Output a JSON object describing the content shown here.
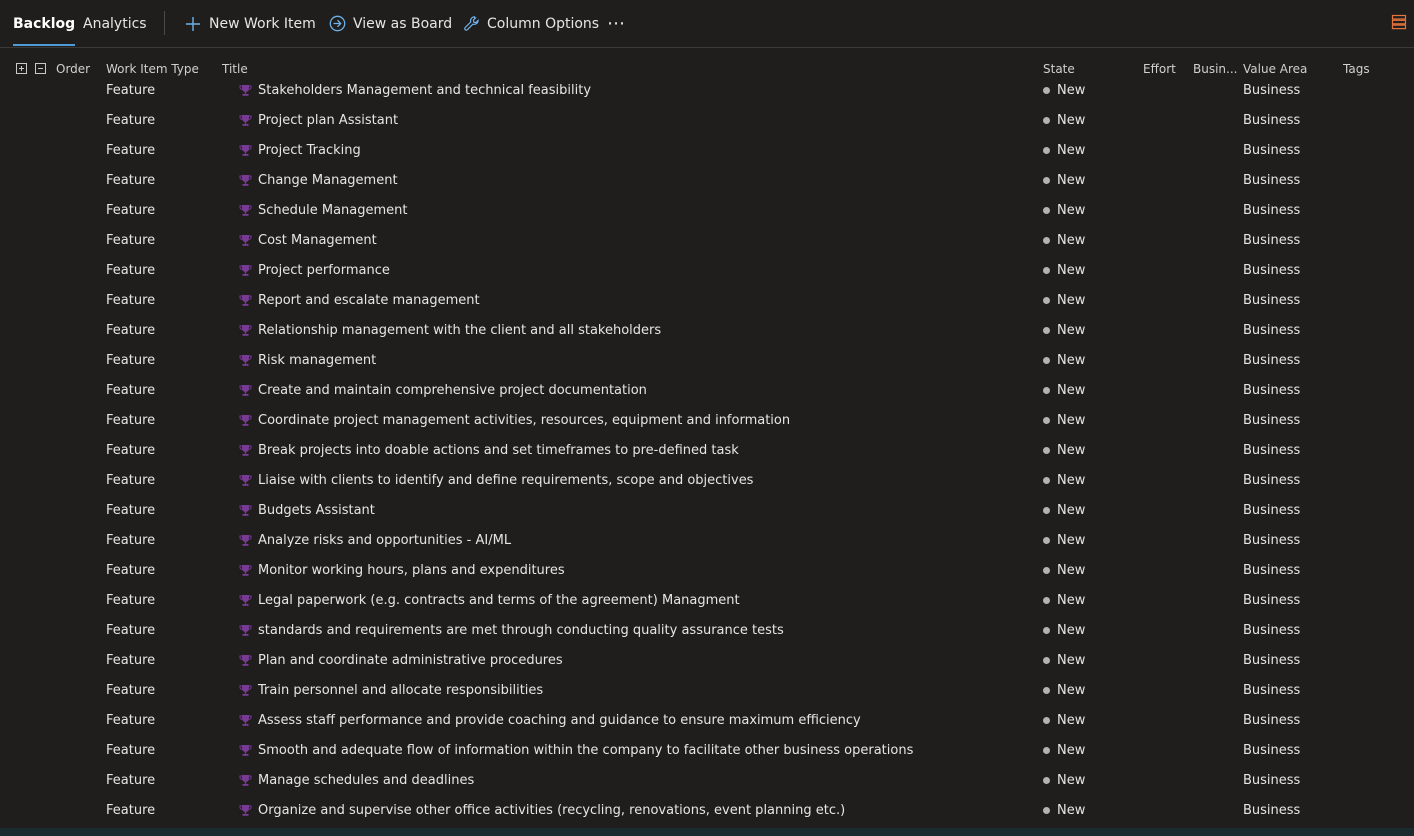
{
  "toolbar": {
    "tabs": [
      {
        "label": "Backlog",
        "active": true
      },
      {
        "label": "Analytics",
        "active": false
      }
    ],
    "new_work_item_label": "New Work Item",
    "view_as_board_label": "View as Board",
    "column_options_label": "Column Options",
    "more_label": "⋯",
    "icons": {
      "new": "plus-icon",
      "board": "arrow-circle-right-icon",
      "columns": "wrench-icon",
      "side_panel": "side-panel-icon"
    },
    "accent_color": "#e8743b"
  },
  "grid": {
    "columns": {
      "order": "Order",
      "type": "Work Item Type",
      "title": "Title",
      "state": "State",
      "effort": "Effort",
      "business": "Busin...",
      "value_area": "Value Area",
      "tags": "Tags"
    },
    "trophy_color": "#773b93",
    "rows": [
      {
        "type": "Feature",
        "title": "Stakeholders Management and technical feasibility",
        "state": "New",
        "value_area": "Business"
      },
      {
        "type": "Feature",
        "title": "Project plan Assistant",
        "state": "New",
        "value_area": "Business"
      },
      {
        "type": "Feature",
        "title": "Project Tracking",
        "state": "New",
        "value_area": "Business"
      },
      {
        "type": "Feature",
        "title": "Change Management",
        "state": "New",
        "value_area": "Business"
      },
      {
        "type": "Feature",
        "title": "Schedule Management",
        "state": "New",
        "value_area": "Business"
      },
      {
        "type": "Feature",
        "title": "Cost Management",
        "state": "New",
        "value_area": "Business"
      },
      {
        "type": "Feature",
        "title": "Project performance",
        "state": "New",
        "value_area": "Business"
      },
      {
        "type": "Feature",
        "title": "Report and escalate management",
        "state": "New",
        "value_area": "Business"
      },
      {
        "type": "Feature",
        "title": "Relationship management with the client and all stakeholders",
        "state": "New",
        "value_area": "Business"
      },
      {
        "type": "Feature",
        "title": "Risk management",
        "state": "New",
        "value_area": "Business"
      },
      {
        "type": "Feature",
        "title": "Create and maintain comprehensive project documentation",
        "state": "New",
        "value_area": "Business"
      },
      {
        "type": "Feature",
        "title": "Coordinate project management activities, resources, equipment and information",
        "state": "New",
        "value_area": "Business"
      },
      {
        "type": "Feature",
        "title": "Break projects into doable actions and set timeframes to pre-defined task",
        "state": "New",
        "value_area": "Business"
      },
      {
        "type": "Feature",
        "title": "Liaise with clients to identify and define requirements, scope and objectives",
        "state": "New",
        "value_area": "Business"
      },
      {
        "type": "Feature",
        "title": "Budgets Assistant",
        "state": "New",
        "value_area": "Business"
      },
      {
        "type": "Feature",
        "title": "Analyze risks and opportunities - AI/ML",
        "state": "New",
        "value_area": "Business"
      },
      {
        "type": "Feature",
        "title": "Monitor working hours, plans and expenditures",
        "state": "New",
        "value_area": "Business"
      },
      {
        "type": "Feature",
        "title": "Legal paperwork (e.g. contracts and terms of the agreement) Managment",
        "state": "New",
        "value_area": "Business"
      },
      {
        "type": "Feature",
        "title": "standards and requirements are met through conducting quality assurance tests",
        "state": "New",
        "value_area": "Business"
      },
      {
        "type": "Feature",
        "title": "Plan and coordinate administrative procedures",
        "state": "New",
        "value_area": "Business"
      },
      {
        "type": "Feature",
        "title": "Train personnel and allocate responsibilities",
        "state": "New",
        "value_area": "Business"
      },
      {
        "type": "Feature",
        "title": "Assess staff performance and provide coaching and guidance to ensure maximum efficiency",
        "state": "New",
        "value_area": "Business"
      },
      {
        "type": "Feature",
        "title": "Smooth and adequate flow of information within the company to facilitate other business operations",
        "state": "New",
        "value_area": "Business"
      },
      {
        "type": "Feature",
        "title": "Manage schedules and deadlines",
        "state": "New",
        "value_area": "Business"
      },
      {
        "type": "Feature",
        "title": "Organize and supervise other office activities (recycling, renovations, event planning etc.)",
        "state": "New",
        "value_area": "Business"
      }
    ]
  }
}
